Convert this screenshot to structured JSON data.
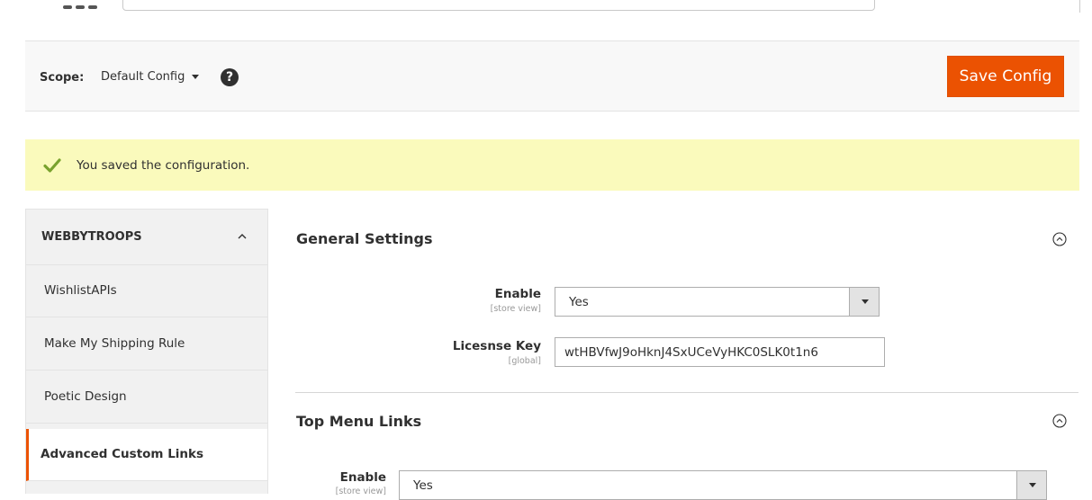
{
  "scope": {
    "label": "Scope:",
    "value": "Default Config",
    "help_icon": "question-circle-icon"
  },
  "toolbar": {
    "save_label": "Save Config"
  },
  "message": {
    "text": "You saved the configuration.",
    "icon": "checkmark-icon",
    "background": "#fafabc"
  },
  "sidebar": {
    "heading": "WEBBYTROOPS",
    "items": [
      {
        "label": "WishlistAPIs",
        "active": false
      },
      {
        "label": "Make My Shipping Rule",
        "active": false
      },
      {
        "label": "Poetic Design",
        "active": false
      },
      {
        "label": "Advanced Custom Links",
        "active": true
      }
    ]
  },
  "sections": {
    "general": {
      "title": "General Settings",
      "enable": {
        "label": "Enable",
        "scope": "[store view]",
        "value": "Yes"
      },
      "license": {
        "label": "Licesnse Key",
        "scope": "[global]",
        "value": "wtHBVfwJ9oHknJ4SxUCeVyHKC0SLK0t1n6"
      }
    },
    "top_menu": {
      "title": "Top Menu Links",
      "enable": {
        "label": "Enable",
        "scope": "[store view]",
        "value": "Yes"
      }
    }
  },
  "colors": {
    "accent": "#eb5202",
    "success": "#79a22e"
  }
}
